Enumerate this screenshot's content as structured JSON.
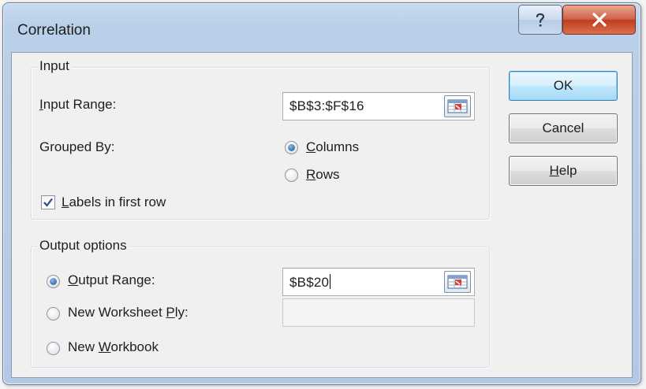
{
  "window": {
    "title": "Correlation",
    "help_button": "?",
    "close_button": "X"
  },
  "input_group": {
    "legend": "Input",
    "input_range_label": "Input Range:",
    "input_range_value": "$B$3:$F$16",
    "grouped_by_label": "Grouped By:",
    "columns_label": "Columns",
    "rows_label": "Rows",
    "grouped_by_selected": "Columns",
    "labels_checkbox_label": "Labels in first row",
    "labels_checked": true
  },
  "output_group": {
    "legend": "Output options",
    "output_range_label": "Output Range:",
    "output_range_value": "$B$20",
    "new_worksheet_label": "New Worksheet Ply:",
    "new_worksheet_value": "",
    "new_workbook_label": "New Workbook",
    "selected": "Output Range"
  },
  "buttons": {
    "ok": "OK",
    "cancel": "Cancel",
    "help": "Help"
  },
  "icons": {
    "refedit": "range-select-icon",
    "checkmark": "checkmark-icon"
  },
  "colors": {
    "accent": "#3c7fb1",
    "close": "#c23b1f",
    "frame": "#b2c9e5"
  }
}
